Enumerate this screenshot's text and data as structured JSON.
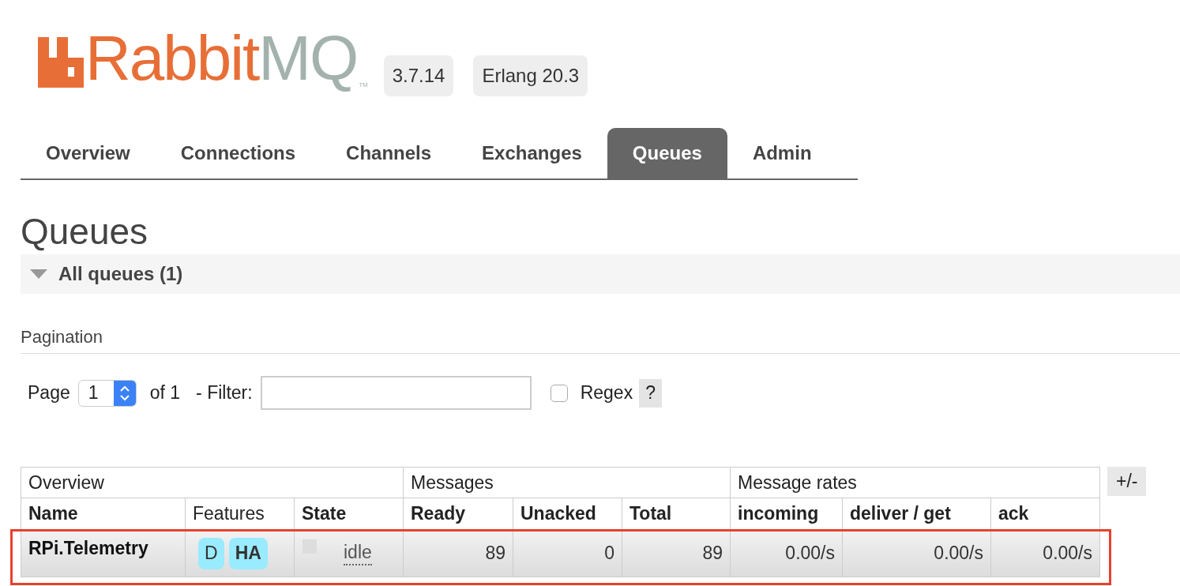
{
  "header": {
    "logo": {
      "brand": "Rabbit",
      "suffix": "MQ",
      "tm": "TM"
    },
    "badges": [
      "3.7.14",
      "Erlang 20.3"
    ]
  },
  "tabs": [
    {
      "label": "Overview",
      "selected": false
    },
    {
      "label": "Connections",
      "selected": false
    },
    {
      "label": "Channels",
      "selected": false
    },
    {
      "label": "Exchanges",
      "selected": false
    },
    {
      "label": "Queues",
      "selected": true
    },
    {
      "label": "Admin",
      "selected": false
    }
  ],
  "page_title": "Queues",
  "section": {
    "title": "All queues (1)",
    "expanded": true
  },
  "pagination": {
    "heading": "Pagination",
    "page_label": "Page",
    "page_value": "1",
    "of_label": "of 1",
    "filter_label": "- Filter:",
    "regex_label": "Regex",
    "regex_checked": false,
    "help": "?"
  },
  "table": {
    "groups": [
      "Overview",
      "Messages",
      "Message rates"
    ],
    "columns": [
      {
        "label": "Name",
        "bold": true
      },
      {
        "label": "Features",
        "bold": false
      },
      {
        "label": "State",
        "bold": true
      },
      {
        "label": "Ready",
        "bold": true
      },
      {
        "label": "Unacked",
        "bold": true
      },
      {
        "label": "Total",
        "bold": true
      },
      {
        "label": "incoming",
        "bold": true
      },
      {
        "label": "deliver / get",
        "bold": true
      },
      {
        "label": "ack",
        "bold": true
      }
    ],
    "toggle": "+/-",
    "rows": [
      {
        "name": "RPi.Telemetry",
        "features": [
          {
            "label": "D",
            "bold": false
          },
          {
            "label": "HA",
            "bold": true
          }
        ],
        "state": "idle",
        "ready": "89",
        "unacked": "0",
        "total": "89",
        "incoming": "0.00/s",
        "deliver_get": "0.00/s",
        "ack": "0.00/s",
        "highlighted": true
      }
    ]
  }
}
